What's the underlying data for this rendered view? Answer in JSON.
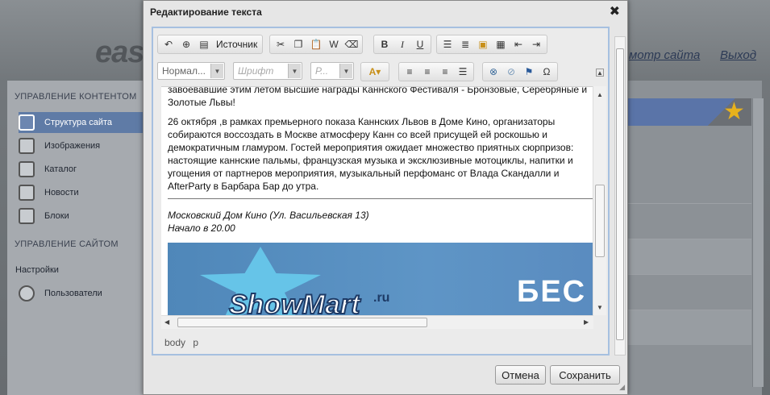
{
  "background": {
    "logo": "eas",
    "links": [
      "мотр сайта",
      "Выход"
    ]
  },
  "sidebar": {
    "section1": "УПРАВЛЕНИЕ КОНТЕНТОМ",
    "items1": [
      "Структура сайта",
      "Изображения",
      "Каталог",
      "Новости",
      "Блоки"
    ],
    "section2": "УПРАВЛЕНИЕ САЙТОМ",
    "items2": [
      "Настройки",
      "Пользователи"
    ]
  },
  "dialog": {
    "title": "Редактирование текста",
    "close": "✖",
    "toolbar": {
      "source_label": "Источник",
      "format": "Нормал...",
      "font": "Шрифт",
      "size": "Р..."
    },
    "content": {
      "cut_text": "завоевавшие этим летом высшие награды Каннского Фестиваля - Бронзовые, Серебряные и Золотые Львы!",
      "paragraph": "26 октября ,в рамках премьерного показа Каннских Львов в Доме Кино, организаторы собираются воссоздать в Москве атмосферу Канн со всей присущей ей роскошью и демократичным гламуром. Гостей мероприятия ожидает множество приятных сюрпризов: настоящие каннские пальмы, французская музыка и эксклюзивные мотоциклы, напитки и угощения от партнеров мероприятия, музыкальный перфоманс от Влада Скандалли и AfterParty в Барбара Бар до утра.",
      "address": "Московский Дом Кино (Ул. Васильевская 13)",
      "time": "Начало в 20.00",
      "banner_logo": "ShowMart",
      "banner_logo_suffix": ".ru",
      "banner_text": "БЕС"
    },
    "statusbar": "body p",
    "cancel": "Отмена",
    "save": "Сохранить"
  },
  "colors": {
    "accent": "#5f7ba6",
    "star": "#e8b21c"
  },
  "icons": [
    "undo-icon",
    "maximize-icon",
    "source-icon",
    "cut-icon",
    "copy-icon",
    "paste-icon",
    "paste-word-icon",
    "eraser-icon",
    "bold-icon",
    "italic-icon",
    "underline-icon",
    "ordered-list-icon",
    "unordered-list-icon",
    "image-icon",
    "table-icon",
    "outdent-icon",
    "indent-icon",
    "text-color-icon",
    "align-left-icon",
    "align-center-icon",
    "align-right-icon",
    "justify-icon",
    "link-icon",
    "unlink-icon",
    "anchor-icon",
    "special-char-icon"
  ]
}
